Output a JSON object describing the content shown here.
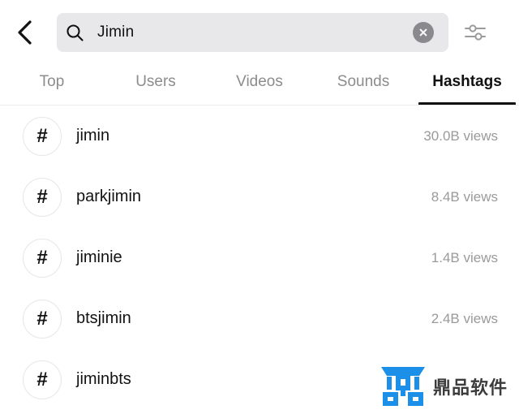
{
  "header": {
    "back_icon": "chevron-left-icon",
    "search": {
      "icon": "search-icon",
      "value": "Jimin",
      "placeholder": "Search",
      "clear_icon": "close-circle-icon",
      "background_color": "#E8E8EA"
    },
    "filter_icon": "sliders-icon"
  },
  "tabs": {
    "items": [
      {
        "label": "Top",
        "active": false
      },
      {
        "label": "Users",
        "active": false
      },
      {
        "label": "Videos",
        "active": false
      },
      {
        "label": "Sounds",
        "active": false
      },
      {
        "label": "Hashtags",
        "active": true
      }
    ],
    "active_color": "#111111",
    "inactive_color": "#8C8C8C"
  },
  "results": {
    "hash_glyph": "#",
    "items": [
      {
        "name": "jimin",
        "views": "30.0B views"
      },
      {
        "name": "parkjimin",
        "views": "8.4B views"
      },
      {
        "name": "jiminie",
        "views": "1.4B views"
      },
      {
        "name": "btsjimin",
        "views": "2.4B views"
      },
      {
        "name": "jiminbts",
        "views": ""
      }
    ]
  },
  "watermark": {
    "logo_icon": "ding-logo-icon",
    "text": "鼎品软件",
    "logo_color": "#1C8FE8",
    "text_color": "#3C3C3C"
  }
}
